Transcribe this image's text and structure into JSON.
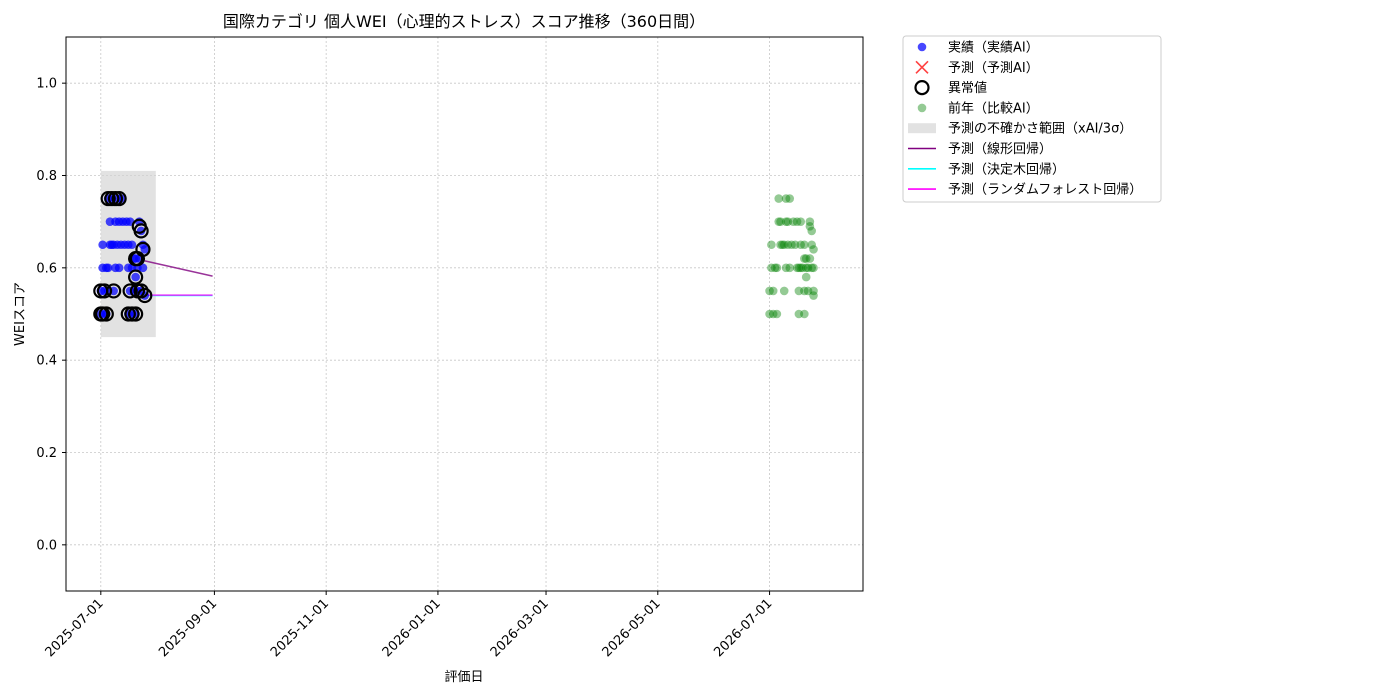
{
  "chart_data": {
    "type": "scatter",
    "title": "国際カテゴリ 個人WEI（心理的ストレス）スコア推移（360日間）",
    "xlabel": "評価日",
    "ylabel": "WEIスコア",
    "xlim": [
      "2025-06-12",
      "2026-08-21"
    ],
    "ylim": [
      -0.1,
      1.1
    ],
    "yticks": [
      "0.0",
      "0.2",
      "0.4",
      "0.6",
      "0.8",
      "1.0"
    ],
    "xticks": [
      "2025-07-01",
      "2025-09-01",
      "2025-11-01",
      "2026-01-01",
      "2026-03-01",
      "2026-05-01",
      "2026-07-01"
    ],
    "grid": true,
    "legend_position": "outside-upper-right",
    "legend": [
      {
        "key": "actual",
        "label": "実績（実績AI）",
        "marker": "circle",
        "color": "#0000ff"
      },
      {
        "key": "predicted",
        "label": "予測（予測AI）",
        "marker": "x",
        "color": "#ff0000"
      },
      {
        "key": "anomaly",
        "label": "異常値",
        "marker": "ring",
        "color": "#000000"
      },
      {
        "key": "previous_year",
        "label": "前年（比較AI）",
        "marker": "circle",
        "color": "#008000"
      },
      {
        "key": "uncertainty",
        "label": "予測の不確かさ範囲（xAI/3σ）",
        "marker": "patch",
        "color": "#d3d3d3"
      },
      {
        "key": "linear",
        "label": "予測（線形回帰）",
        "marker": "line",
        "color": "#800080"
      },
      {
        "key": "tree",
        "label": "予測（決定木回帰）",
        "marker": "line",
        "color": "#00ffff"
      },
      {
        "key": "forest",
        "label": "予測（ランダムフォレスト回帰）",
        "marker": "line",
        "color": "#ff00ff"
      }
    ],
    "uncertainty_band": {
      "x_start": "2025-07-01",
      "x_end": "2025-07-31",
      "y_low": 0.45,
      "y_high": 0.81
    },
    "series": [
      {
        "name": "実績（実績AI）",
        "key": "actual",
        "color": "#0000ff",
        "points": [
          [
            "2025-07-01",
            0.5
          ],
          [
            "2025-07-01",
            0.55
          ],
          [
            "2025-07-02",
            0.65
          ],
          [
            "2025-07-02",
            0.6
          ],
          [
            "2025-07-03",
            0.5
          ],
          [
            "2025-07-03",
            0.55
          ],
          [
            "2025-07-04",
            0.6
          ],
          [
            "2025-07-04",
            0.5
          ],
          [
            "2025-07-05",
            0.75
          ],
          [
            "2025-07-05",
            0.55
          ],
          [
            "2025-07-05",
            0.6
          ],
          [
            "2025-07-06",
            0.7
          ],
          [
            "2025-07-06",
            0.65
          ],
          [
            "2025-07-07",
            0.75
          ],
          [
            "2025-07-07",
            0.65
          ],
          [
            "2025-07-08",
            0.55
          ],
          [
            "2025-07-08",
            0.65
          ],
          [
            "2025-07-09",
            0.7
          ],
          [
            "2025-07-09",
            0.6
          ],
          [
            "2025-07-10",
            0.75
          ],
          [
            "2025-07-10",
            0.65
          ],
          [
            "2025-07-11",
            0.7
          ],
          [
            "2025-07-11",
            0.6
          ],
          [
            "2025-07-12",
            0.75
          ],
          [
            "2025-07-12",
            0.65
          ],
          [
            "2025-07-13",
            0.7
          ],
          [
            "2025-07-14",
            0.65
          ],
          [
            "2025-07-15",
            0.7
          ],
          [
            "2025-07-16",
            0.5
          ],
          [
            "2025-07-16",
            0.6
          ],
          [
            "2025-07-16",
            0.65
          ],
          [
            "2025-07-17",
            0.55
          ],
          [
            "2025-07-17",
            0.7
          ],
          [
            "2025-07-18",
            0.5
          ],
          [
            "2025-07-18",
            0.6
          ],
          [
            "2025-07-18",
            0.65
          ],
          [
            "2025-07-19",
            0.55
          ],
          [
            "2025-07-19",
            0.62
          ],
          [
            "2025-07-20",
            0.5
          ],
          [
            "2025-07-20",
            0.58
          ],
          [
            "2025-07-20",
            0.62
          ],
          [
            "2025-07-21",
            0.55
          ],
          [
            "2025-07-21",
            0.6
          ],
          [
            "2025-07-22",
            0.62
          ],
          [
            "2025-07-22",
            0.7
          ],
          [
            "2025-07-23",
            0.55
          ],
          [
            "2025-07-23",
            0.68
          ],
          [
            "2025-07-24",
            0.6
          ],
          [
            "2025-07-24",
            0.65
          ],
          [
            "2025-07-25",
            0.54
          ],
          [
            "2025-07-25",
            0.64
          ]
        ]
      },
      {
        "name": "異常値",
        "key": "anomaly",
        "color": "#000000",
        "points": [
          [
            "2025-07-01",
            0.5
          ],
          [
            "2025-07-01",
            0.55
          ],
          [
            "2025-07-02",
            0.5
          ],
          [
            "2025-07-03",
            0.55
          ],
          [
            "2025-07-04",
            0.5
          ],
          [
            "2025-07-05",
            0.75
          ],
          [
            "2025-07-07",
            0.75
          ],
          [
            "2025-07-08",
            0.55
          ],
          [
            "2025-07-09",
            0.75
          ],
          [
            "2025-07-11",
            0.75
          ],
          [
            "2025-07-16",
            0.5
          ],
          [
            "2025-07-17",
            0.55
          ],
          [
            "2025-07-18",
            0.5
          ],
          [
            "2025-07-20",
            0.5
          ],
          [
            "2025-07-20",
            0.58
          ],
          [
            "2025-07-20",
            0.62
          ],
          [
            "2025-07-21",
            0.55
          ],
          [
            "2025-07-21",
            0.62
          ],
          [
            "2025-07-22",
            0.69
          ],
          [
            "2025-07-23",
            0.55
          ],
          [
            "2025-07-23",
            0.68
          ],
          [
            "2025-07-24",
            0.64
          ],
          [
            "2025-07-25",
            0.54
          ]
        ]
      },
      {
        "name": "前年（比較AI）",
        "key": "previous_year",
        "color": "#008000",
        "points": [
          [
            "2026-07-01",
            0.5
          ],
          [
            "2026-07-01",
            0.55
          ],
          [
            "2026-07-02",
            0.6
          ],
          [
            "2026-07-02",
            0.65
          ],
          [
            "2026-07-03",
            0.5
          ],
          [
            "2026-07-03",
            0.55
          ],
          [
            "2026-07-04",
            0.6
          ],
          [
            "2026-07-05",
            0.6
          ],
          [
            "2026-07-05",
            0.5
          ],
          [
            "2026-07-06",
            0.7
          ],
          [
            "2026-07-06",
            0.75
          ],
          [
            "2026-07-07",
            0.65
          ],
          [
            "2026-07-07",
            0.7
          ],
          [
            "2026-07-08",
            0.65
          ],
          [
            "2026-07-09",
            0.55
          ],
          [
            "2026-07-09",
            0.65
          ],
          [
            "2026-07-10",
            0.6
          ],
          [
            "2026-07-10",
            0.7
          ],
          [
            "2026-07-10",
            0.75
          ],
          [
            "2026-07-11",
            0.65
          ],
          [
            "2026-07-11",
            0.7
          ],
          [
            "2026-07-12",
            0.6
          ],
          [
            "2026-07-12",
            0.75
          ],
          [
            "2026-07-13",
            0.65
          ],
          [
            "2026-07-14",
            0.7
          ],
          [
            "2026-07-15",
            0.65
          ],
          [
            "2026-07-16",
            0.6
          ],
          [
            "2026-07-16",
            0.7
          ],
          [
            "2026-07-17",
            0.5
          ],
          [
            "2026-07-17",
            0.55
          ],
          [
            "2026-07-17",
            0.6
          ],
          [
            "2026-07-18",
            0.6
          ],
          [
            "2026-07-18",
            0.65
          ],
          [
            "2026-07-18",
            0.7
          ],
          [
            "2026-07-19",
            0.6
          ],
          [
            "2026-07-20",
            0.55
          ],
          [
            "2026-07-20",
            0.5
          ],
          [
            "2026-07-20",
            0.62
          ],
          [
            "2026-07-20",
            0.65
          ],
          [
            "2026-07-21",
            0.58
          ],
          [
            "2026-07-21",
            0.6
          ],
          [
            "2026-07-21",
            0.62
          ],
          [
            "2026-07-22",
            0.55
          ],
          [
            "2026-07-22",
            0.6
          ],
          [
            "2026-07-23",
            0.62
          ],
          [
            "2026-07-23",
            0.7
          ],
          [
            "2026-07-23",
            0.69
          ],
          [
            "2026-07-24",
            0.6
          ],
          [
            "2026-07-24",
            0.65
          ],
          [
            "2026-07-24",
            0.68
          ],
          [
            "2026-07-25",
            0.55
          ],
          [
            "2026-07-25",
            0.64
          ],
          [
            "2026-07-25",
            0.54
          ],
          [
            "2026-07-25",
            0.6
          ]
        ]
      }
    ],
    "lines": [
      {
        "name": "予測（線形回帰）",
        "key": "linear",
        "color": "#800080",
        "x": [
          "2025-07-25",
          "2025-08-31"
        ],
        "y": [
          0.615,
          0.582
        ]
      },
      {
        "name": "予測（決定木回帰）",
        "key": "tree",
        "color": "#00ffff",
        "x": [
          "2025-07-25",
          "2025-08-31"
        ],
        "y": [
          0.54,
          0.54
        ]
      },
      {
        "name": "予測（ランダムフォレスト回帰）",
        "key": "forest",
        "color": "#ff00ff",
        "x": [
          "2025-07-25",
          "2025-08-31"
        ],
        "y": [
          0.541,
          0.541
        ]
      }
    ]
  }
}
